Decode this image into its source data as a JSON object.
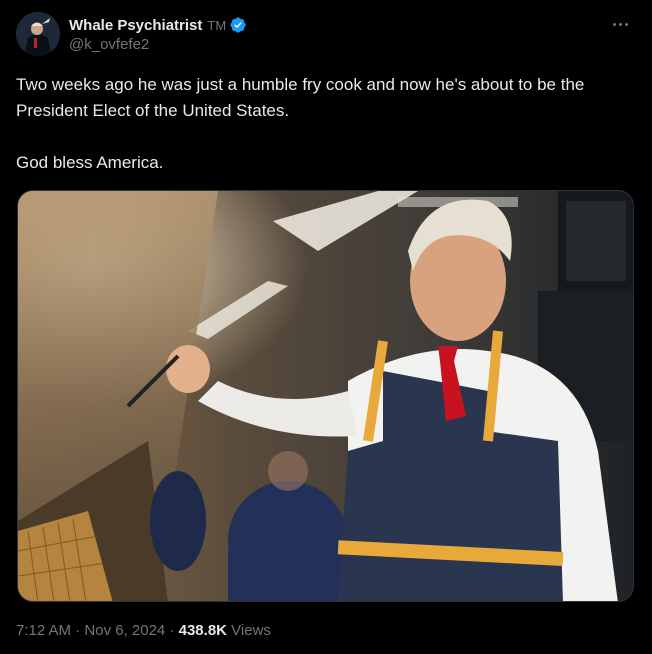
{
  "author": {
    "display_name": "Whale Psychiatrist",
    "suffix": "TM",
    "handle": "@k_ovfefe2",
    "verified": true
  },
  "tweet": {
    "line1": "Two weeks ago he was just a humble fry cook and now he's about to be the President Elect of the United States.",
    "line2": "God bless America."
  },
  "meta": {
    "time": "7:12 AM",
    "separator": "·",
    "date": "Nov 6, 2024",
    "views_count": "438.8K",
    "views_label": "Views"
  },
  "colors": {
    "background": "#000000",
    "text": "#e7e9ea",
    "secondary": "#71767b",
    "verified": "#1d9bf0"
  },
  "icons": {
    "verified": "verified-badge-icon",
    "more": "more-options-icon"
  }
}
